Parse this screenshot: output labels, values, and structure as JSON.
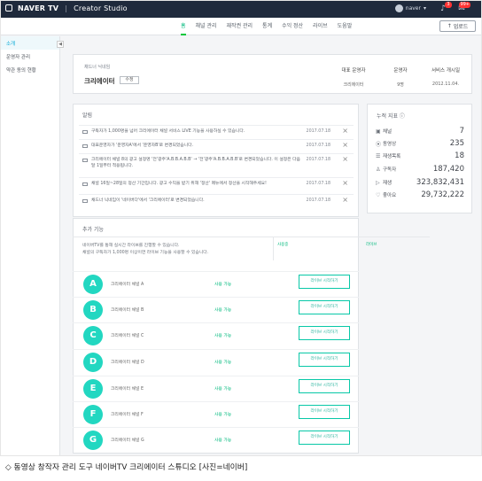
{
  "app": {
    "brand": "NAVER TV",
    "title": "Creator Studio",
    "user_name": "naver",
    "notification_badge": "3",
    "message_badge": "99+"
  },
  "nav": {
    "tabs": [
      "홈",
      "채널 관리",
      "재작권 관리",
      "통계",
      "수익 정산",
      "라이브",
      "도움말"
    ],
    "active_tab": "홈",
    "upload_label": "업로드"
  },
  "sidebar": {
    "items": [
      "소개",
      "운영자 관리",
      "약관 동의 현황"
    ],
    "active_item": "소개"
  },
  "profile": {
    "small_label": "채드너 닉네임",
    "name": "크리에이터",
    "edit_label": "수정",
    "columns": [
      {
        "label": "대표 운영자",
        "value": "크리에이터"
      },
      {
        "label": "운영자",
        "value": "9명"
      },
      {
        "label": "서비스 개시일",
        "value": "2012.11.04."
      }
    ]
  },
  "notices": {
    "title": "알림",
    "items": [
      {
        "text": "구독자가 1,000명을 넘어 크리에이터 채널 서비스 LIVE 기능을 사용하실 수 있습니다.",
        "date": "2017.07.18"
      },
      {
        "text": "대표운영자가 '운영자A'에서 '운영자B'로 변경되었습니다.",
        "date": "2017.07.18"
      },
      {
        "text": "크리에이터 채널 8의 광고 설정명 '전'광주'A.B.B.A.B.B' → '전'광주'A.B.B.A.B.B'로 변경되었습니다. 이 설정은 다음 달 1일부터 적용됩니다.",
        "date": "2017.07.18"
      },
      {
        "text": "채널 16일~28일의 정산 기간입니다. 광고 수익을 받기 위해 '정산' 메뉴에서 정산을 시작해주세요!",
        "date": "2017.07.18"
      },
      {
        "text": "채드너 닉네임이 '네이버다'에서 '크리에이터'로 변경되었습니다.",
        "date": "2017.07.18"
      }
    ]
  },
  "stats": {
    "title": "누적 지표",
    "items": [
      {
        "label": "채널",
        "value": "7",
        "icon": "channel-icon"
      },
      {
        "label": "동영상",
        "value": "235",
        "icon": "video-icon"
      },
      {
        "label": "재생목록",
        "value": "18",
        "icon": "playlist-icon"
      },
      {
        "label": "구독자",
        "value": "187,420",
        "icon": "subscriber-icon"
      },
      {
        "label": "재생",
        "value": "323,832,431",
        "icon": "play-icon"
      },
      {
        "label": "좋아요",
        "value": "29,732,222",
        "icon": "heart-icon"
      }
    ]
  },
  "live": {
    "title": "추가 기능",
    "description": [
      "네이버TV를 통해 실시간 라이브를 진행할 수 있습니다.",
      "채널의 구독자가 1,000명 이상이면 라이브 기능을 사용할 수 있습니다."
    ],
    "column_labels": [
      "사용중",
      "라이브"
    ],
    "channels": [
      {
        "letter": "A",
        "name": "크리에이터 채널 A",
        "status": "사용 가능",
        "button": "라이브 시작하기"
      },
      {
        "letter": "B",
        "name": "크리에이터 채널 B",
        "status": "사용 가능",
        "button": "라이브 시작하기"
      },
      {
        "letter": "C",
        "name": "크리에이터 채널 C",
        "status": "사용 가능",
        "button": "라이브 시작하기"
      },
      {
        "letter": "D",
        "name": "크리에이터 채널 D",
        "status": "사용 가능",
        "button": "라이브 시작하기"
      },
      {
        "letter": "E",
        "name": "크리에이터 채널 E",
        "status": "사용 가능",
        "button": "라이브 시작하기"
      },
      {
        "letter": "F",
        "name": "크리에이터 채널 F",
        "status": "사용 가능",
        "button": "라이브 시작하기"
      },
      {
        "letter": "G",
        "name": "크리에이터 채널 G",
        "status": "사용 가능",
        "button": "라이브 시작하기"
      }
    ]
  },
  "caption": "◇ 동영상 창작자 관리 도구 네이버TV 크리에이터 스튜디오 [사진=네이버]",
  "colors": {
    "topbar": "#1f2a3c",
    "accent": "#00c73c",
    "teal": "#22d7c1"
  }
}
